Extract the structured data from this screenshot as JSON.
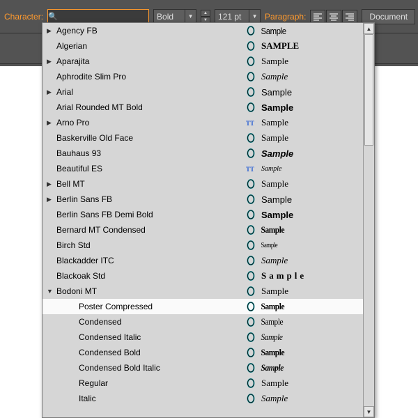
{
  "toolbar": {
    "character_label": "Character:",
    "font_search_value": "",
    "weight_value": "Bold",
    "size_value": "121 pt",
    "paragraph_label": "Paragraph:",
    "document_label": "Document"
  },
  "fonts": [
    {
      "name": "Agency FB",
      "expand": "closed",
      "iconType": "O",
      "sample": "Sample",
      "styles": [
        "s-cond"
      ]
    },
    {
      "name": "Algerian",
      "expand": "none",
      "iconType": "O",
      "sample": "SAMPLE",
      "styles": [
        "s-serif",
        "s-bold"
      ]
    },
    {
      "name": "Aparajita",
      "expand": "closed",
      "iconType": "O",
      "sample": "Sample",
      "styles": [
        "s-serif"
      ]
    },
    {
      "name": "Aphrodite Slim Pro",
      "expand": "none",
      "iconType": "O",
      "sample": "Sample",
      "styles": [
        "s-script"
      ]
    },
    {
      "name": "Arial",
      "expand": "closed",
      "iconType": "O",
      "sample": "Sample",
      "styles": []
    },
    {
      "name": "Arial Rounded MT Bold",
      "expand": "none",
      "iconType": "O",
      "sample": "Sample",
      "styles": [
        "s-bold"
      ]
    },
    {
      "name": "Arno Pro",
      "expand": "closed",
      "iconType": "TT",
      "sample": "Sample",
      "styles": [
        "s-serif"
      ]
    },
    {
      "name": "Baskerville Old Face",
      "expand": "none",
      "iconType": "O",
      "sample": "Sample",
      "styles": [
        "s-serif"
      ]
    },
    {
      "name": "Bauhaus 93",
      "expand": "none",
      "iconType": "O",
      "sample": "Sample",
      "styles": [
        "s-bold",
        "s-italic"
      ]
    },
    {
      "name": "Beautiful ES",
      "expand": "none",
      "iconType": "TT",
      "sample": "Sample",
      "styles": [
        "s-script",
        "s-tiny"
      ]
    },
    {
      "name": "Bell MT",
      "expand": "closed",
      "iconType": "O",
      "sample": "Sample",
      "styles": [
        "s-serif"
      ]
    },
    {
      "name": "Berlin Sans FB",
      "expand": "closed",
      "iconType": "O",
      "sample": "Sample",
      "styles": []
    },
    {
      "name": "Berlin Sans FB Demi Bold",
      "expand": "none",
      "iconType": "O",
      "sample": "Sample",
      "styles": [
        "s-bold"
      ]
    },
    {
      "name": "Bernard MT Condensed",
      "expand": "none",
      "iconType": "O",
      "sample": "Sample",
      "styles": [
        "s-bold",
        "s-cond",
        "s-serif"
      ]
    },
    {
      "name": "Birch Std",
      "expand": "none",
      "iconType": "O",
      "sample": "Sample",
      "styles": [
        "s-cond",
        "s-serif",
        "s-tiny"
      ]
    },
    {
      "name": "Blackadder ITC",
      "expand": "none",
      "iconType": "O",
      "sample": "Sample",
      "styles": [
        "s-script"
      ]
    },
    {
      "name": "Blackoak Std",
      "expand": "none",
      "iconType": "O",
      "sample": "Sample",
      "styles": [
        "s-wide"
      ]
    },
    {
      "name": "Bodoni MT",
      "expand": "open",
      "iconType": "O",
      "sample": "Sample",
      "styles": [
        "s-serif"
      ]
    },
    {
      "name": "Poster Compressed",
      "expand": "child",
      "iconType": "O",
      "sample": "Sample",
      "styles": [
        "s-bold",
        "s-cond",
        "s-serif"
      ],
      "hover": true
    },
    {
      "name": "Condensed",
      "expand": "child",
      "iconType": "O",
      "sample": "Sample",
      "styles": [
        "s-cond",
        "s-serif"
      ]
    },
    {
      "name": "Condensed Italic",
      "expand": "child",
      "iconType": "O",
      "sample": "Sample",
      "styles": [
        "s-cond",
        "s-italic",
        "s-serif"
      ]
    },
    {
      "name": "Condensed Bold",
      "expand": "child",
      "iconType": "O",
      "sample": "Sample",
      "styles": [
        "s-cond",
        "s-bold",
        "s-serif"
      ]
    },
    {
      "name": "Condensed Bold Italic",
      "expand": "child",
      "iconType": "O",
      "sample": "Sample",
      "styles": [
        "s-cond",
        "s-bold",
        "s-italic",
        "s-serif"
      ]
    },
    {
      "name": "Regular",
      "expand": "child",
      "iconType": "O",
      "sample": "Sample",
      "styles": [
        "s-serif"
      ]
    },
    {
      "name": "Italic",
      "expand": "child",
      "iconType": "O",
      "sample": "Sample",
      "styles": [
        "s-italic",
        "s-serif"
      ]
    }
  ]
}
